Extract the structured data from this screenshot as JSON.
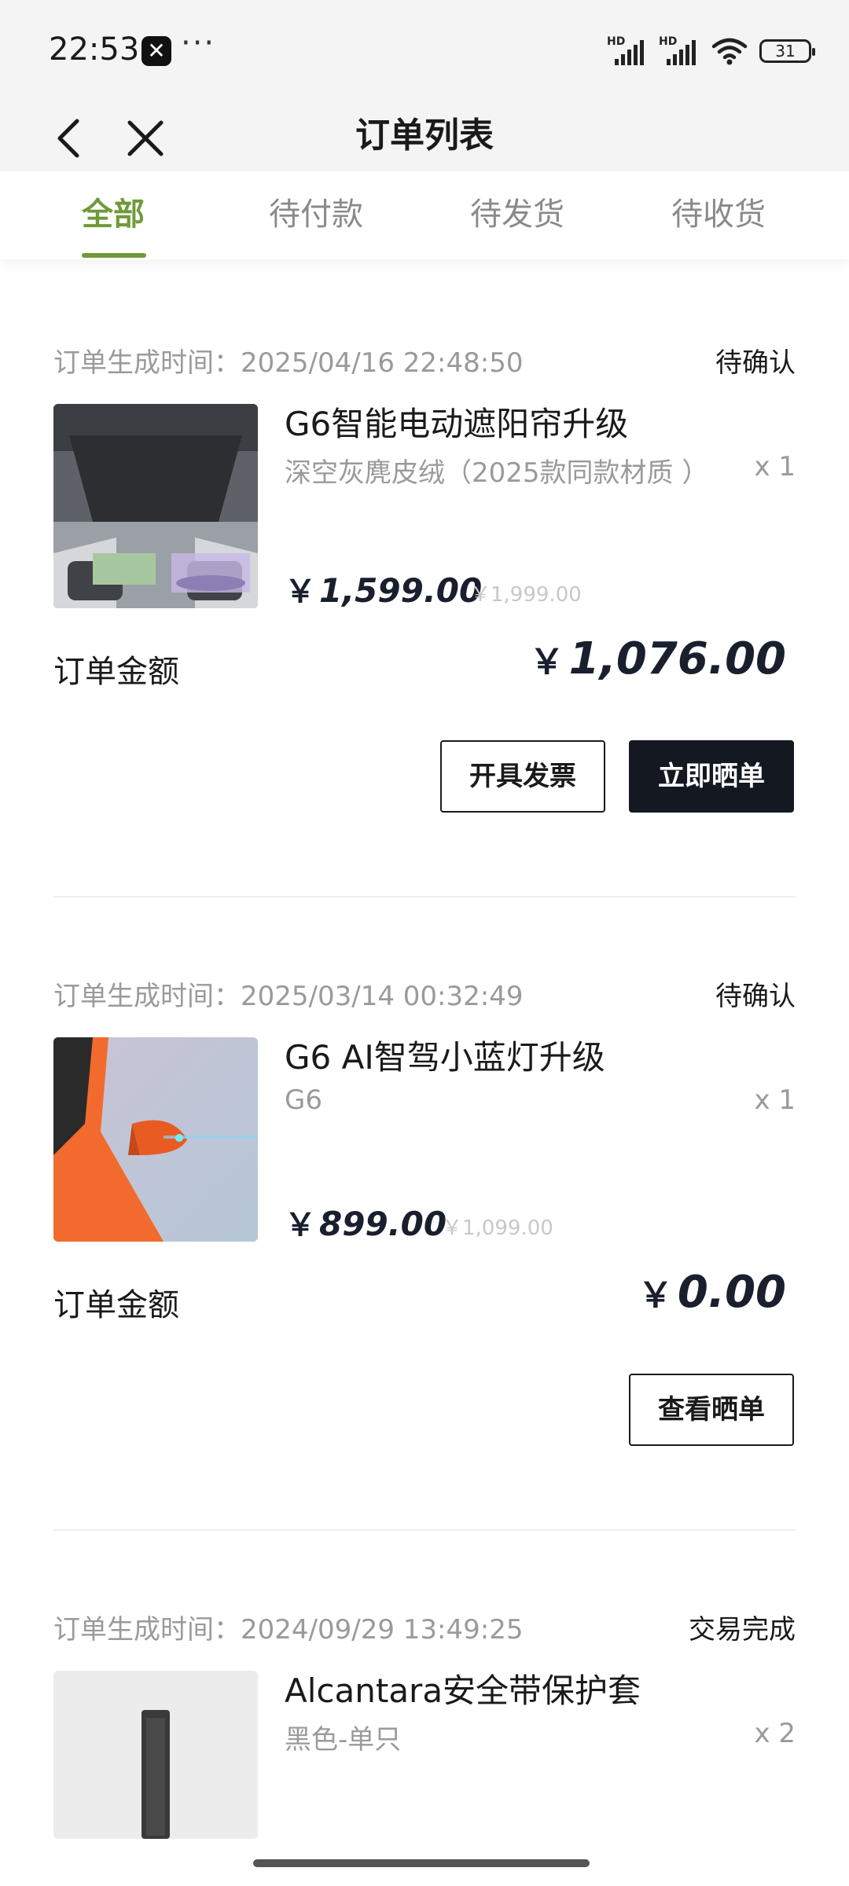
{
  "status_bar": {
    "time": "22:53",
    "app_icon": "x-app-icon",
    "dots": "···",
    "signal_1_label": "HD",
    "signal_2_label": "HD",
    "battery": "31"
  },
  "header": {
    "title": "订单列表",
    "back_icon": "chevron-left-icon",
    "close_icon": "close-icon"
  },
  "tabs": [
    {
      "label": "全部",
      "active": true
    },
    {
      "label": "待付款",
      "active": false
    },
    {
      "label": "待发货",
      "active": false
    },
    {
      "label": "待收货",
      "active": false
    }
  ],
  "orders": [
    {
      "time": "订单生成时间：2025/04/16 22:48:50",
      "status": "待确认",
      "name": "G6智能电动遮阳帘升级",
      "spec": "深空灰麂皮绒（2025款同款材质 ）",
      "qty": "x 1",
      "price_symbol": "￥",
      "price": "1,599.00",
      "old_price": "￥1,999.00",
      "total_label": "订单金额",
      "total_symbol": "￥",
      "total": "1,076.00",
      "buttons": [
        "开具发票",
        "立即晒单"
      ]
    },
    {
      "time": "订单生成时间：2025/03/14 00:32:49",
      "status": "待确认",
      "name": "G6 AI智驾小蓝灯升级",
      "spec": "G6",
      "qty": "x 1",
      "price_symbol": "￥",
      "price": "899.00",
      "old_price": "￥1,099.00",
      "total_label": "订单金额",
      "total_symbol": "￥",
      "total": "0.00",
      "buttons": [
        "查看晒单"
      ]
    },
    {
      "time": "订单生成时间：2024/09/29 13:49:25",
      "status": "交易完成",
      "name": "Alcantara安全带保护套",
      "spec": "黑色-单只",
      "qty": "x 2"
    }
  ],
  "colors": {
    "accent": "#6f9a3a",
    "dark": "#141821",
    "muted": "#9a9a9a"
  }
}
